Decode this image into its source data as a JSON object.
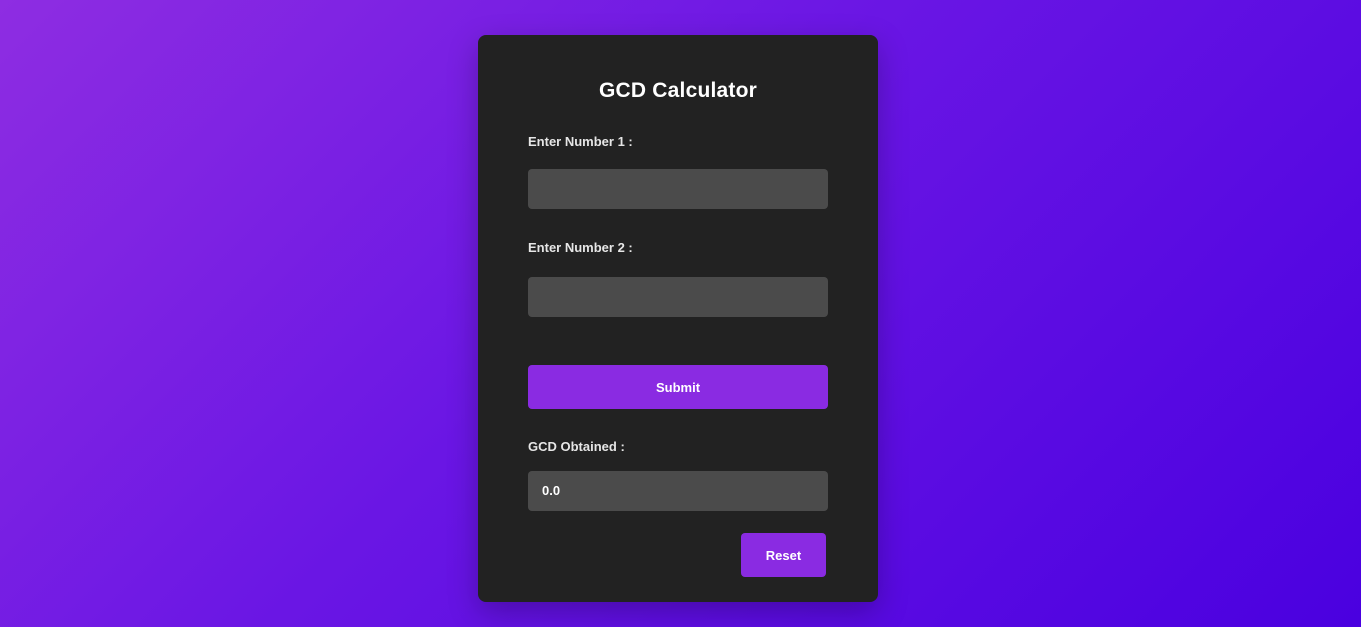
{
  "title": "GCD Calculator",
  "form": {
    "number1_label": "Enter Number 1 :",
    "number1_value": "",
    "number2_label": "Enter Number 2 :",
    "number2_value": "",
    "submit_label": "Submit",
    "result_label": "GCD Obtained :",
    "result_value": "0.0",
    "reset_label": "Reset"
  },
  "colors": {
    "background_start": "#8e2de2",
    "background_end": "#4a00e0",
    "card": "#222222",
    "field": "#4b4b4b",
    "accent": "#8a2be2"
  }
}
